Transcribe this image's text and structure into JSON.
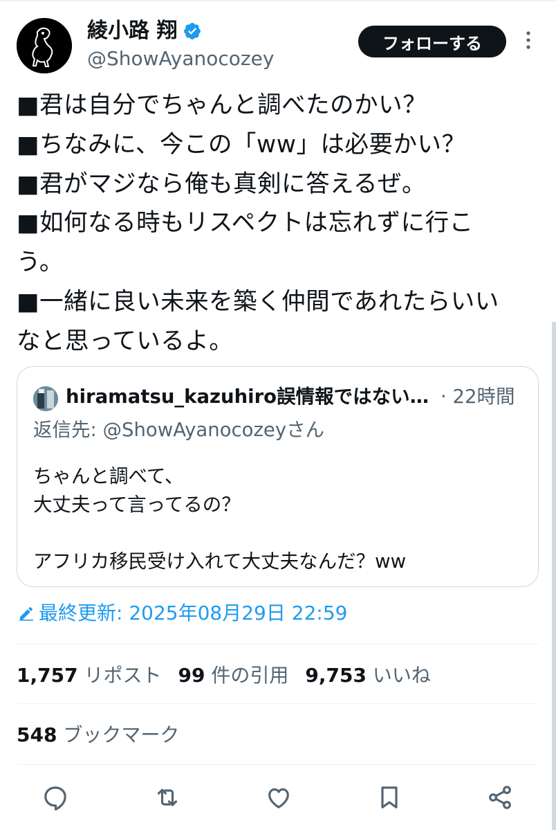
{
  "author": {
    "name": "綾小路 翔",
    "handle": "@ShowAyanocozey",
    "verified": true
  },
  "follow_button": "フォローする",
  "tweet_lines": [
    "■君は自分でちゃんと調べたのかい？",
    "■ちなみに、今この「ww」は必要かい？",
    "■君がマジなら俺も真剣に答えるぜ。",
    "■如何なる時もリスペクトは忘れずに行こ",
    "う。",
    "■一緒に良い未来を築く仲間であれたらいい",
    "なと思っているよ。"
  ],
  "quote": {
    "author": "hiramatsu_kazuhiro誤情報ではない…",
    "time": "· 22時間",
    "reply_to": "返信先: @ShowAyanocozeyさん",
    "lines": [
      "ちゃんと調べて、",
      "大丈夫って言ってるの？",
      "",
      "アフリカ移民受け入れて大丈夫なんだ？ww"
    ]
  },
  "edited": "最終更新: 2025年08月29日 22:59",
  "stats": {
    "reposts_count": "1,757",
    "reposts_label": "リポスト",
    "quotes_count": "99",
    "quotes_label": "件の引用",
    "likes_count": "9,753",
    "likes_label": "いいね",
    "bookmarks_count": "548",
    "bookmarks_label": "ブックマーク"
  },
  "actions": [
    "reply-icon",
    "repost-icon",
    "like-icon",
    "bookmark-icon",
    "share-icon"
  ],
  "colors": {
    "accent": "#1d9bf0",
    "text": "#0f1419",
    "secondary": "#536471",
    "border": "#cfd9de"
  }
}
